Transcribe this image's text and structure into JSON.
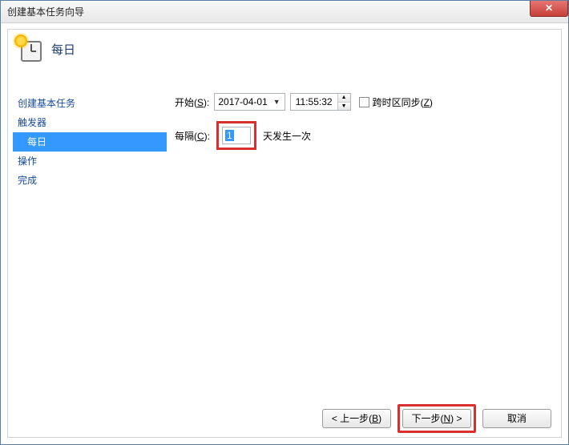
{
  "window": {
    "title": "创建基本任务向导",
    "close_glyph": "✕"
  },
  "header": {
    "title": "每日"
  },
  "sidebar": {
    "items": [
      {
        "label": "创建基本任务",
        "indent": false,
        "selected": false
      },
      {
        "label": "触发器",
        "indent": false,
        "selected": false
      },
      {
        "label": "每日",
        "indent": true,
        "selected": true
      },
      {
        "label": "操作",
        "indent": false,
        "selected": false
      },
      {
        "label": "完成",
        "indent": false,
        "selected": false
      }
    ]
  },
  "form": {
    "start_label_pre": "开始(",
    "start_label_key": "S",
    "start_label_post": "):",
    "date_value": "2017-04-01",
    "dropdown_glyph": "▼",
    "time_value": "11:55:32",
    "spin_up": "▲",
    "spin_down": "▼",
    "tz_label_pre": "跨时区同步(",
    "tz_label_key": "Z",
    "tz_label_post": ")",
    "interval_label_pre": "每隔(",
    "interval_label_key": "C",
    "interval_label_post": "):",
    "interval_value": "1",
    "interval_suffix": "天发生一次"
  },
  "footer": {
    "back_pre": "< 上一步(",
    "back_key": "B",
    "back_post": ")",
    "next_pre": "下一步(",
    "next_key": "N",
    "next_post": ") >",
    "cancel": "取消"
  }
}
